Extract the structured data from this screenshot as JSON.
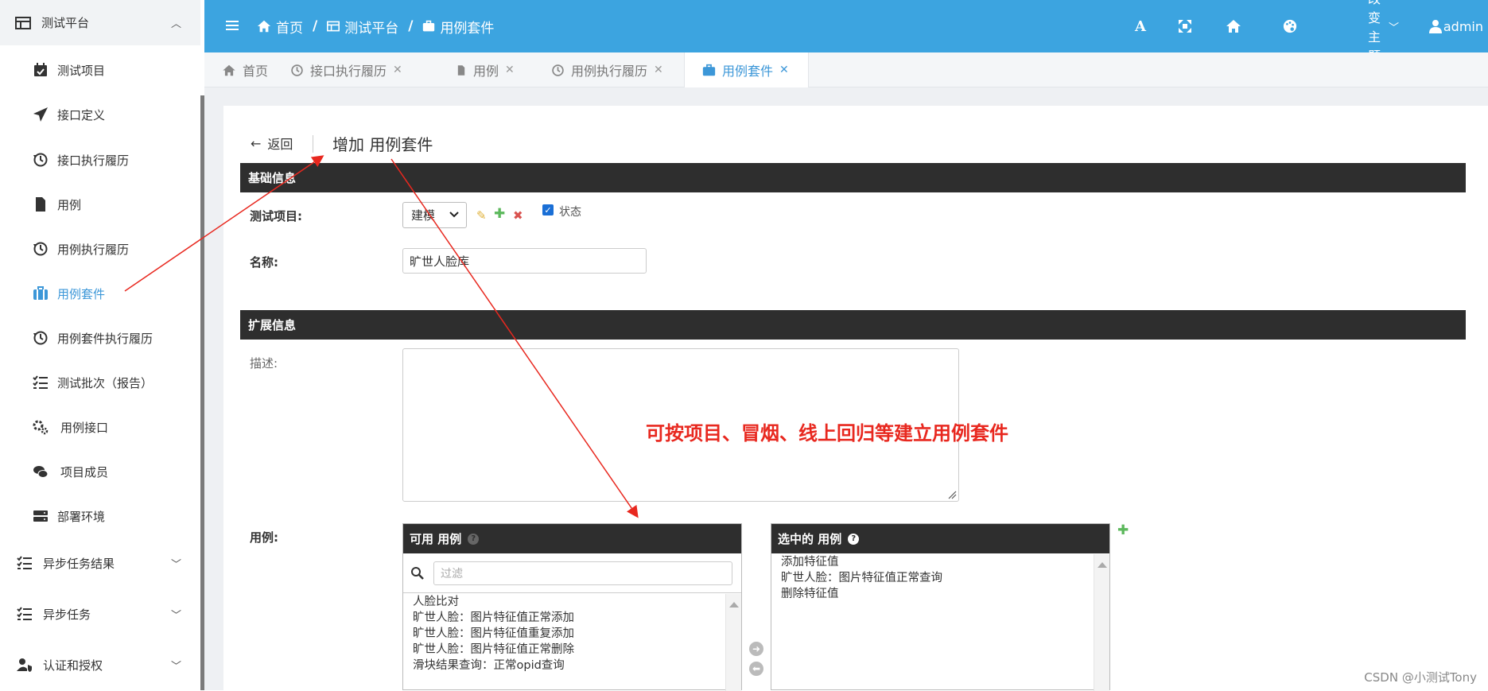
{
  "sidebar": {
    "top": {
      "label": "测试平台",
      "icon": "table-icon"
    },
    "items": [
      {
        "label": "测试项目",
        "icon": "calendar-check-icon"
      },
      {
        "label": "接口定义",
        "icon": "paper-plane-icon"
      },
      {
        "label": "接口执行履历",
        "icon": "history-icon"
      },
      {
        "label": "用例",
        "icon": "file-icon"
      },
      {
        "label": "用例执行履历",
        "icon": "history-icon"
      },
      {
        "label": "用例套件",
        "icon": "suitcase-icon",
        "active": true
      },
      {
        "label": "用例套件执行履历",
        "icon": "history-icon"
      },
      {
        "label": "测试批次（报告）",
        "icon": "tasks-icon"
      },
      {
        "label": "用例接口",
        "icon": "cogs-icon"
      },
      {
        "label": "项目成员",
        "icon": "comments-icon"
      },
      {
        "label": "部署环境",
        "icon": "server-icon"
      }
    ],
    "groups": [
      {
        "label": "异步任务结果",
        "icon": "tasks-icon"
      },
      {
        "label": "异步任务",
        "icon": "tasks-icon"
      },
      {
        "label": "认证和授权",
        "icon": "user-shield-icon"
      }
    ]
  },
  "header": {
    "breadcrumbs": [
      "首页",
      "测试平台",
      "用例套件"
    ],
    "theme_label": "改变主题",
    "user": "admin",
    "color": "#3ca4e0"
  },
  "tabs": [
    {
      "label": "首页",
      "closable": false
    },
    {
      "label": "接口执行履历",
      "closable": true
    },
    {
      "label": "用例",
      "closable": true
    },
    {
      "label": "用例执行履历",
      "closable": true
    },
    {
      "label": "用例套件",
      "closable": true,
      "active": true
    }
  ],
  "form": {
    "back_label": "返回",
    "title": "增加 用例套件",
    "basic_section": "基础信息",
    "project_label": "测试项目:",
    "project_value": "建模",
    "status_label": "状态",
    "status_checked": true,
    "name_label": "名称:",
    "name_value": "旷世人脸库",
    "ext_section": "扩展信息",
    "desc_label": "描述:",
    "cases_label": "用例:"
  },
  "available": {
    "title": "可用 用例",
    "filter_placeholder": "过滤",
    "items": [
      "人脸比对",
      "旷世人脸：图片特征值正常添加",
      "旷世人脸：图片特征值重复添加",
      "旷世人脸：图片特征值正常删除",
      "滑块结果查询：正常opid查询"
    ]
  },
  "selected": {
    "title": "选中的 用例",
    "items": [
      "添加特征值",
      "旷世人脸：图片特征值正常查询",
      "删除特征值"
    ]
  },
  "annotation": "可按项目、冒烟、线上回归等建立用例套件",
  "watermark": "CSDN @小测试Tony"
}
